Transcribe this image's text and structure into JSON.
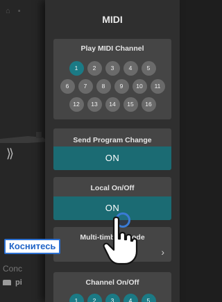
{
  "drawer": {
    "title": "MIDI"
  },
  "play_midi_channel": {
    "title": "Play MIDI Channel",
    "channels": [
      "1",
      "2",
      "3",
      "4",
      "5",
      "6",
      "7",
      "8",
      "9",
      "10",
      "11",
      "12",
      "13",
      "14",
      "15",
      "16"
    ],
    "selected": "1"
  },
  "send_program_change": {
    "title": "Send Program Change",
    "value": "ON"
  },
  "local_on_off": {
    "title": "Local On/Off",
    "value": "ON"
  },
  "multi_timbral_mode": {
    "title": "Multi-timbral Mode",
    "chevron": "›"
  },
  "channel_on_off": {
    "title": "Channel On/Off",
    "channels": [
      "1",
      "2",
      "3",
      "4",
      "5"
    ]
  },
  "tap_hint": {
    "label": "Коснитесь"
  },
  "background": {
    "chevron": "⟩⟩",
    "text_conc": "Conc",
    "text_pi": "pi"
  },
  "colors": {
    "accent": "#1b6b73",
    "selected_channel": "#1b7a85",
    "hint_blue": "#2a6fd1"
  }
}
